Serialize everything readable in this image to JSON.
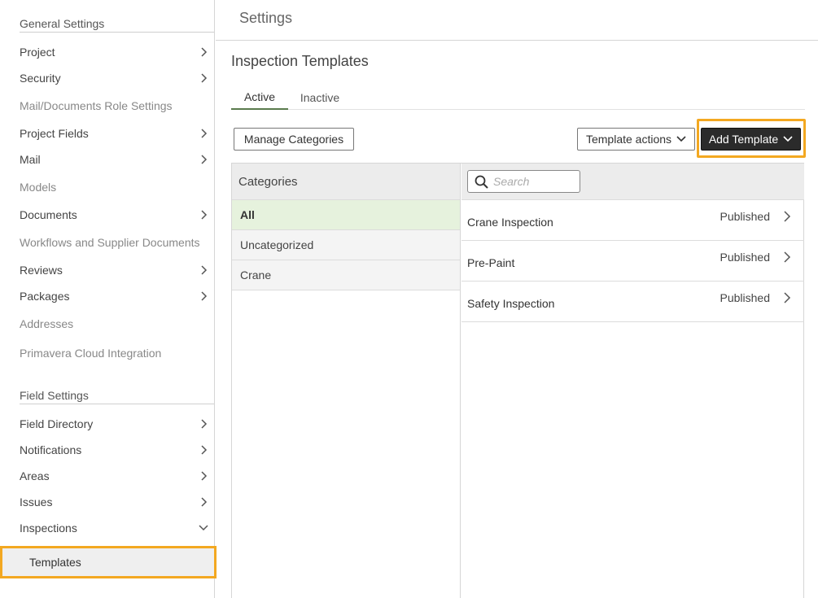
{
  "sidebar": {
    "general_title": "General Settings",
    "general_items": [
      {
        "label": "Project",
        "chevron": true,
        "enabled": true
      },
      {
        "label": "Security",
        "chevron": true,
        "enabled": true
      },
      {
        "label": "Mail/Documents Role Settings",
        "chevron": false,
        "enabled": false
      },
      {
        "label": "Project Fields",
        "chevron": true,
        "enabled": true
      },
      {
        "label": "Mail",
        "chevron": true,
        "enabled": true
      },
      {
        "label": "Models",
        "chevron": false,
        "enabled": false
      },
      {
        "label": "Documents",
        "chevron": true,
        "enabled": true
      },
      {
        "label": "Workflows and Supplier Documents",
        "chevron": false,
        "enabled": false
      },
      {
        "label": "Reviews",
        "chevron": true,
        "enabled": true
      },
      {
        "label": "Packages",
        "chevron": true,
        "enabled": true
      },
      {
        "label": "Addresses",
        "chevron": false,
        "enabled": false
      },
      {
        "label": "Primavera Cloud Integration",
        "chevron": false,
        "enabled": false
      }
    ],
    "field_title": "Field Settings",
    "field_items": [
      {
        "label": "Field Directory",
        "chevron": "right"
      },
      {
        "label": "Notifications",
        "chevron": "right"
      },
      {
        "label": "Areas",
        "chevron": "right"
      },
      {
        "label": "Issues",
        "chevron": "right"
      },
      {
        "label": "Inspections",
        "chevron": "down"
      }
    ],
    "selected_sub_item": "Templates"
  },
  "header": {
    "title": "Settings"
  },
  "page": {
    "title": "Inspection Templates"
  },
  "tabs": [
    {
      "label": "Active",
      "active": true
    },
    {
      "label": "Inactive",
      "active": false
    }
  ],
  "toolbar": {
    "manage_categories": "Manage Categories",
    "template_actions": "Template actions",
    "add_template": "Add Template"
  },
  "categories": {
    "header": "Categories",
    "items": [
      {
        "label": "All",
        "selected": true
      },
      {
        "label": "Uncategorized",
        "selected": false
      },
      {
        "label": "Crane",
        "selected": false
      }
    ]
  },
  "templates": {
    "search_placeholder": "Search",
    "rows": [
      {
        "name": "Crane Inspection",
        "status": "Published"
      },
      {
        "name": "Pre-Paint",
        "status": "Published"
      },
      {
        "name": "Safety Inspection",
        "status": "Published"
      }
    ]
  },
  "colors": {
    "highlight": "#f3a821",
    "tab_active": "#5a7b4d",
    "selected_category_bg": "#e6f2dd",
    "primary_button": "#2b2b2b"
  }
}
